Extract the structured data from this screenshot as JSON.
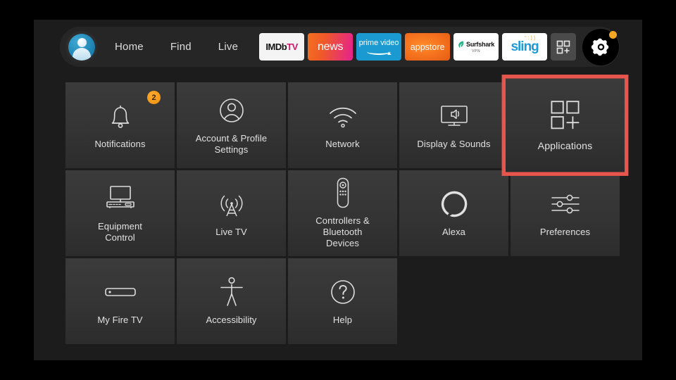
{
  "colors": {
    "background": "#000000",
    "content_bg": "#1c1c1c",
    "navbar_bg": "#262626",
    "tile_bg": "#343434",
    "selection_border": "#e8554c",
    "badge_orange": "#f09010",
    "text": "#e2e2e2"
  },
  "navbar": {
    "avatar_name": "profile-avatar",
    "links": [
      {
        "label": "Home"
      },
      {
        "label": "Find"
      },
      {
        "label": "Live"
      }
    ],
    "apps": [
      {
        "name": "imdb-tv",
        "text_a": "IMDb",
        "text_b": "TV"
      },
      {
        "name": "news",
        "label": "news"
      },
      {
        "name": "prime-video",
        "label": "prime video"
      },
      {
        "name": "appstore",
        "label": "appstore"
      },
      {
        "name": "surfshark",
        "label": "Surfshark",
        "sub": "VPN"
      },
      {
        "name": "sling",
        "label": "sling",
        "dots": "\" : ) )"
      }
    ],
    "apps_grid_label": "apps-grid",
    "settings_gear_label": "settings-gear",
    "gear_notification": true
  },
  "grid": {
    "tiles": [
      {
        "name": "notifications",
        "label": "Notifications",
        "icon": "bell-icon",
        "badge": "2"
      },
      {
        "name": "account-profile",
        "label": "Account & Profile\nSettings",
        "icon": "person-circle-icon"
      },
      {
        "name": "network",
        "label": "Network",
        "icon": "wifi-icon"
      },
      {
        "name": "display-sounds",
        "label": "Display & Sounds",
        "icon": "tv-speaker-icon"
      },
      {
        "name": "applications",
        "label": "Applications",
        "icon": "apps-plus-icon",
        "selected": true
      },
      {
        "name": "equipment-control",
        "label": "Equipment\nControl",
        "icon": "tv-receiver-icon"
      },
      {
        "name": "live-tv",
        "label": "Live TV",
        "icon": "antenna-icon"
      },
      {
        "name": "controllers-bluetooth",
        "label": "Controllers & Bluetooth\nDevices",
        "icon": "remote-icon"
      },
      {
        "name": "alexa",
        "label": "Alexa",
        "icon": "alexa-ring-icon"
      },
      {
        "name": "preferences",
        "label": "Preferences",
        "icon": "sliders-icon"
      },
      {
        "name": "my-fire-tv",
        "label": "My Fire TV",
        "icon": "firestick-icon"
      },
      {
        "name": "accessibility",
        "label": "Accessibility",
        "icon": "accessibility-icon"
      },
      {
        "name": "help",
        "label": "Help",
        "icon": "question-circle-icon"
      }
    ]
  }
}
